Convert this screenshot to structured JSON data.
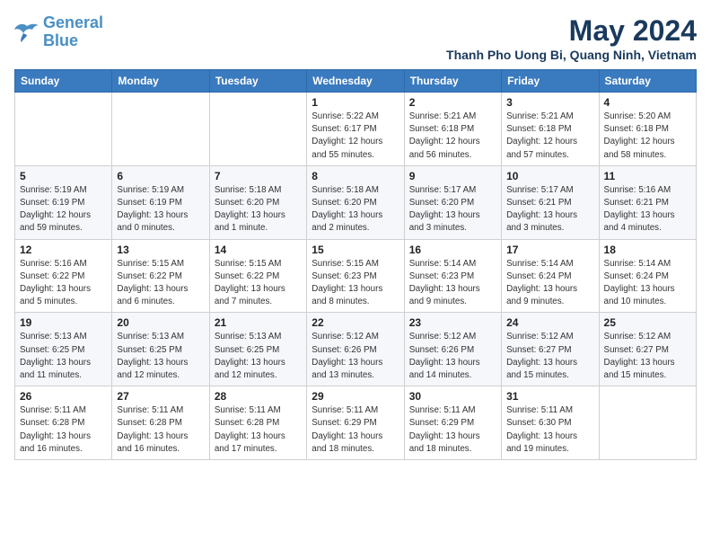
{
  "logo": {
    "line1": "General",
    "line2": "Blue"
  },
  "title": "May 2024",
  "location": "Thanh Pho Uong Bi, Quang Ninh, Vietnam",
  "weekdays": [
    "Sunday",
    "Monday",
    "Tuesday",
    "Wednesday",
    "Thursday",
    "Friday",
    "Saturday"
  ],
  "weeks": [
    [
      {
        "day": "",
        "info": ""
      },
      {
        "day": "",
        "info": ""
      },
      {
        "day": "",
        "info": ""
      },
      {
        "day": "1",
        "info": "Sunrise: 5:22 AM\nSunset: 6:17 PM\nDaylight: 12 hours\nand 55 minutes."
      },
      {
        "day": "2",
        "info": "Sunrise: 5:21 AM\nSunset: 6:18 PM\nDaylight: 12 hours\nand 56 minutes."
      },
      {
        "day": "3",
        "info": "Sunrise: 5:21 AM\nSunset: 6:18 PM\nDaylight: 12 hours\nand 57 minutes."
      },
      {
        "day": "4",
        "info": "Sunrise: 5:20 AM\nSunset: 6:18 PM\nDaylight: 12 hours\nand 58 minutes."
      }
    ],
    [
      {
        "day": "5",
        "info": "Sunrise: 5:19 AM\nSunset: 6:19 PM\nDaylight: 12 hours\nand 59 minutes."
      },
      {
        "day": "6",
        "info": "Sunrise: 5:19 AM\nSunset: 6:19 PM\nDaylight: 13 hours\nand 0 minutes."
      },
      {
        "day": "7",
        "info": "Sunrise: 5:18 AM\nSunset: 6:20 PM\nDaylight: 13 hours\nand 1 minute."
      },
      {
        "day": "8",
        "info": "Sunrise: 5:18 AM\nSunset: 6:20 PM\nDaylight: 13 hours\nand 2 minutes."
      },
      {
        "day": "9",
        "info": "Sunrise: 5:17 AM\nSunset: 6:20 PM\nDaylight: 13 hours\nand 3 minutes."
      },
      {
        "day": "10",
        "info": "Sunrise: 5:17 AM\nSunset: 6:21 PM\nDaylight: 13 hours\nand 3 minutes."
      },
      {
        "day": "11",
        "info": "Sunrise: 5:16 AM\nSunset: 6:21 PM\nDaylight: 13 hours\nand 4 minutes."
      }
    ],
    [
      {
        "day": "12",
        "info": "Sunrise: 5:16 AM\nSunset: 6:22 PM\nDaylight: 13 hours\nand 5 minutes."
      },
      {
        "day": "13",
        "info": "Sunrise: 5:15 AM\nSunset: 6:22 PM\nDaylight: 13 hours\nand 6 minutes."
      },
      {
        "day": "14",
        "info": "Sunrise: 5:15 AM\nSunset: 6:22 PM\nDaylight: 13 hours\nand 7 minutes."
      },
      {
        "day": "15",
        "info": "Sunrise: 5:15 AM\nSunset: 6:23 PM\nDaylight: 13 hours\nand 8 minutes."
      },
      {
        "day": "16",
        "info": "Sunrise: 5:14 AM\nSunset: 6:23 PM\nDaylight: 13 hours\nand 9 minutes."
      },
      {
        "day": "17",
        "info": "Sunrise: 5:14 AM\nSunset: 6:24 PM\nDaylight: 13 hours\nand 9 minutes."
      },
      {
        "day": "18",
        "info": "Sunrise: 5:14 AM\nSunset: 6:24 PM\nDaylight: 13 hours\nand 10 minutes."
      }
    ],
    [
      {
        "day": "19",
        "info": "Sunrise: 5:13 AM\nSunset: 6:25 PM\nDaylight: 13 hours\nand 11 minutes."
      },
      {
        "day": "20",
        "info": "Sunrise: 5:13 AM\nSunset: 6:25 PM\nDaylight: 13 hours\nand 12 minutes."
      },
      {
        "day": "21",
        "info": "Sunrise: 5:13 AM\nSunset: 6:25 PM\nDaylight: 13 hours\nand 12 minutes."
      },
      {
        "day": "22",
        "info": "Sunrise: 5:12 AM\nSunset: 6:26 PM\nDaylight: 13 hours\nand 13 minutes."
      },
      {
        "day": "23",
        "info": "Sunrise: 5:12 AM\nSunset: 6:26 PM\nDaylight: 13 hours\nand 14 minutes."
      },
      {
        "day": "24",
        "info": "Sunrise: 5:12 AM\nSunset: 6:27 PM\nDaylight: 13 hours\nand 15 minutes."
      },
      {
        "day": "25",
        "info": "Sunrise: 5:12 AM\nSunset: 6:27 PM\nDaylight: 13 hours\nand 15 minutes."
      }
    ],
    [
      {
        "day": "26",
        "info": "Sunrise: 5:11 AM\nSunset: 6:28 PM\nDaylight: 13 hours\nand 16 minutes."
      },
      {
        "day": "27",
        "info": "Sunrise: 5:11 AM\nSunset: 6:28 PM\nDaylight: 13 hours\nand 16 minutes."
      },
      {
        "day": "28",
        "info": "Sunrise: 5:11 AM\nSunset: 6:28 PM\nDaylight: 13 hours\nand 17 minutes."
      },
      {
        "day": "29",
        "info": "Sunrise: 5:11 AM\nSunset: 6:29 PM\nDaylight: 13 hours\nand 18 minutes."
      },
      {
        "day": "30",
        "info": "Sunrise: 5:11 AM\nSunset: 6:29 PM\nDaylight: 13 hours\nand 18 minutes."
      },
      {
        "day": "31",
        "info": "Sunrise: 5:11 AM\nSunset: 6:30 PM\nDaylight: 13 hours\nand 19 minutes."
      },
      {
        "day": "",
        "info": ""
      }
    ]
  ]
}
